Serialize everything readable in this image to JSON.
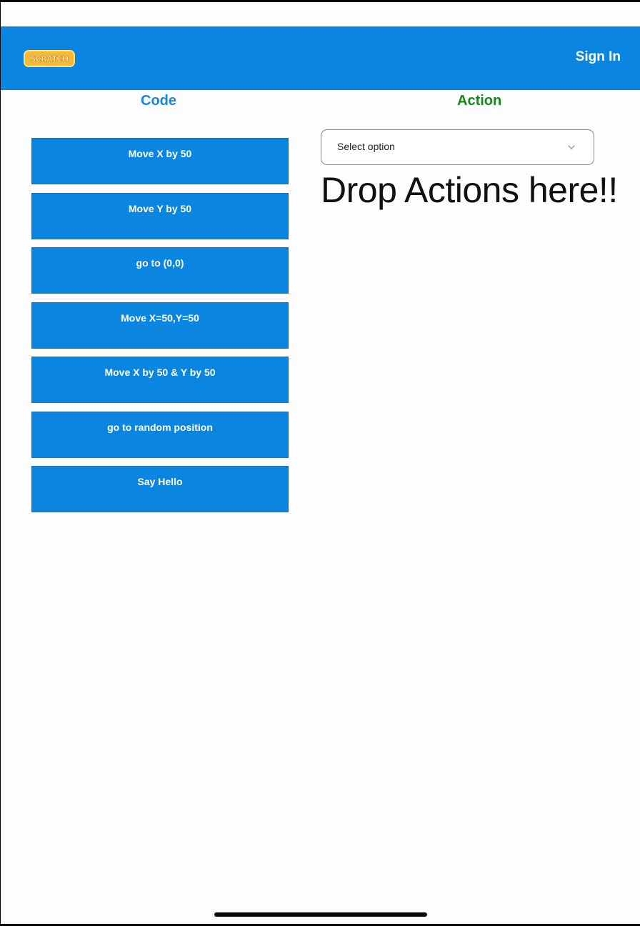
{
  "header": {
    "logo_text": "SCRATCH",
    "signin_label": "Sign In"
  },
  "columns": {
    "code_title": "Code",
    "action_title": "Action"
  },
  "blocks": [
    {
      "label": "Move X by 50"
    },
    {
      "label": "Move Y by 50"
    },
    {
      "label": "go to (0,0)"
    },
    {
      "label": "Move X=50,Y=50"
    },
    {
      "label": "Move X by 50 & Y by 50"
    },
    {
      "label": "go to random position"
    },
    {
      "label": "Say Hello"
    }
  ],
  "action_select": {
    "placeholder": "Select option",
    "icon": "chevron-down-icon"
  },
  "drop_zone": {
    "text": "Drop Actions here!!"
  },
  "colors": {
    "header": "#0b86e0",
    "block": "#0b86e0",
    "code_title": "#1a86d8",
    "action_title": "#118a17"
  }
}
